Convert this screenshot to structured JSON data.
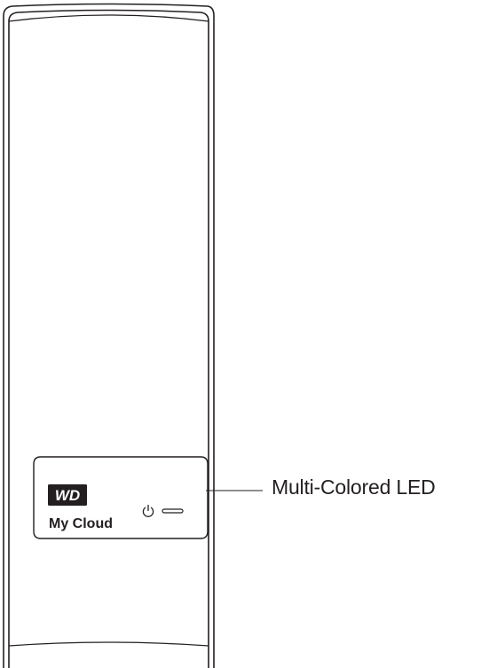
{
  "device": {
    "logo_text": "WD",
    "brand_name": "My Cloud",
    "power_icon": "power-icon"
  },
  "callout": {
    "label": "Multi-Colored LED"
  },
  "colors": {
    "stroke": "#231f20",
    "logo_fill": "#231f20",
    "logo_text": "#ffffff",
    "background": "#ffffff"
  }
}
